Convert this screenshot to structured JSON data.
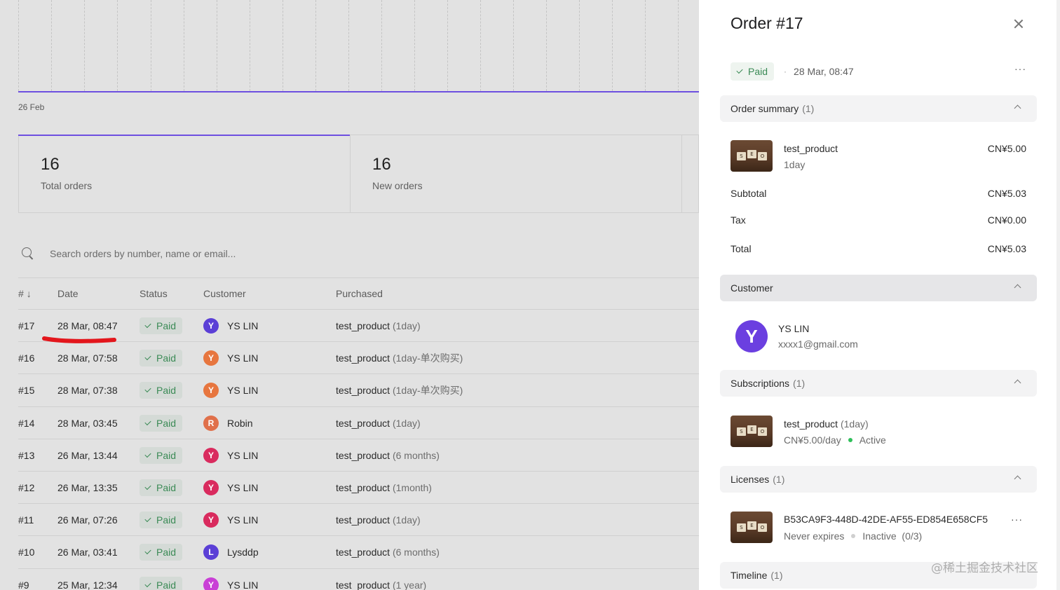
{
  "chart": {
    "date_label": "26 Feb"
  },
  "stats": [
    {
      "value": "16",
      "label": "Total orders"
    },
    {
      "value": "16",
      "label": "New orders"
    }
  ],
  "search": {
    "placeholder": "Search orders by number, name or email..."
  },
  "table": {
    "headers": {
      "num": "#",
      "date": "Date",
      "status": "Status",
      "customer": "Customer",
      "purchased": "Purchased"
    },
    "rows": [
      {
        "num": "#17",
        "date": "28 Mar, 08:47",
        "status": "Paid",
        "initial": "Y",
        "color": "#5b3fd6",
        "customer": "YS LIN",
        "product": "test_product",
        "variant": "(1day)"
      },
      {
        "num": "#16",
        "date": "28 Mar, 07:58",
        "status": "Paid",
        "initial": "Y",
        "color": "#e7763f",
        "customer": "YS LIN",
        "product": "test_product",
        "variant": "(1day-单次购买)"
      },
      {
        "num": "#15",
        "date": "28 Mar, 07:38",
        "status": "Paid",
        "initial": "Y",
        "color": "#e7763f",
        "customer": "YS LIN",
        "product": "test_product",
        "variant": "(1day-单次购买)"
      },
      {
        "num": "#14",
        "date": "28 Mar, 03:45",
        "status": "Paid",
        "initial": "R",
        "color": "#e0704a",
        "customer": "Robin",
        "product": "test_product",
        "variant": "(1day)"
      },
      {
        "num": "#13",
        "date": "26 Mar, 13:44",
        "status": "Paid",
        "initial": "Y",
        "color": "#d92b5e",
        "customer": "YS LIN",
        "product": "test_product",
        "variant": "(6 months)"
      },
      {
        "num": "#12",
        "date": "26 Mar, 13:35",
        "status": "Paid",
        "initial": "Y",
        "color": "#d92b5e",
        "customer": "YS LIN",
        "product": "test_product",
        "variant": "(1month)"
      },
      {
        "num": "#11",
        "date": "26 Mar, 07:26",
        "status": "Paid",
        "initial": "Y",
        "color": "#d92b5e",
        "customer": "YS LIN",
        "product": "test_product",
        "variant": "(1day)"
      },
      {
        "num": "#10",
        "date": "26 Mar, 03:41",
        "status": "Paid",
        "initial": "L",
        "color": "#5b3fd6",
        "customer": "Lysddp",
        "product": "test_product",
        "variant": "(6 months)"
      },
      {
        "num": "#9",
        "date": "25 Mar, 12:34",
        "status": "Paid",
        "initial": "Y",
        "color": "#c93fd6",
        "customer": "YS LIN",
        "product": "test_product",
        "variant": "(1 year)"
      }
    ]
  },
  "panel": {
    "title": "Order #17",
    "status": "Paid",
    "date": "28 Mar, 08:47",
    "more": "···",
    "order_summary": {
      "label": "Order summary",
      "count": "(1)",
      "item_name": "test_product",
      "item_variant": "1day",
      "item_price": "CN¥5.00",
      "subtotal_label": "Subtotal",
      "subtotal": "CN¥5.03",
      "tax_label": "Tax",
      "tax": "CN¥0.00",
      "total_label": "Total",
      "total": "CN¥5.03"
    },
    "customer": {
      "label": "Customer",
      "initial": "Y",
      "name": "YS LIN",
      "email": "xxxx1@gmail.com"
    },
    "subscriptions": {
      "label": "Subscriptions",
      "count": "(1)",
      "item_name": "test_product",
      "item_variant": "(1day)",
      "price": "CN¥5.00/day",
      "status": "Active"
    },
    "licenses": {
      "label": "Licenses",
      "count": "(1)",
      "key": "B53CA9F3-448D-42DE-AF55-ED854E658CF5",
      "expiry": "Never expires",
      "status": "Inactive",
      "activations": "(0/3)"
    },
    "timeline": {
      "label": "Timeline",
      "count": "(1)"
    }
  },
  "watermark": "@稀土掘金技术社区",
  "colors": {
    "accent": "#6d4fe0",
    "paid_green": "#3a8a55",
    "annotation_red": "#e3161c"
  }
}
